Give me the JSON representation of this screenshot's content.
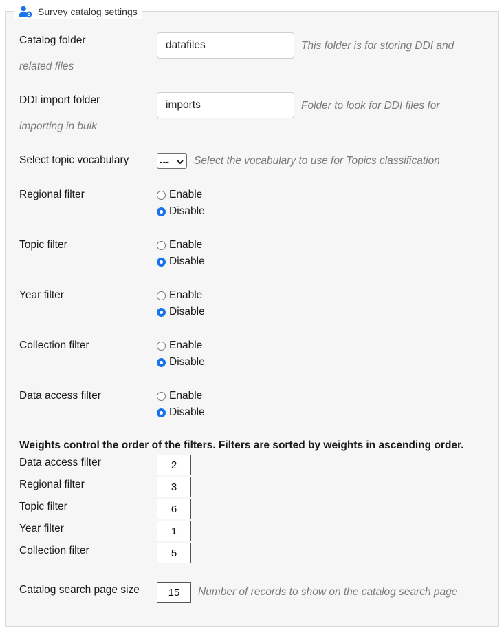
{
  "legend": {
    "title": "Survey catalog settings",
    "icon": "user-gear-icon"
  },
  "catalog_folder": {
    "label": "Catalog folder",
    "value": "datafiles",
    "help_line1": "This folder is for storing DDI and",
    "help_line2": "related files"
  },
  "ddi_import_folder": {
    "label": "DDI import folder",
    "value": "imports",
    "help_line1": "Folder to look for DDI files for",
    "help_line2": "importing in bulk"
  },
  "topic_vocabulary": {
    "label": "Select topic vocabulary",
    "selected": "---",
    "help": "Select the vocabulary to use for Topics classification"
  },
  "filters": [
    {
      "label": "Regional filter",
      "enable": "Enable",
      "disable": "Disable",
      "value": "Disable"
    },
    {
      "label": "Topic filter",
      "enable": "Enable",
      "disable": "Disable",
      "value": "Disable"
    },
    {
      "label": "Year filter",
      "enable": "Enable",
      "disable": "Disable",
      "value": "Disable"
    },
    {
      "label": "Collection filter",
      "enable": "Enable",
      "disable": "Disable",
      "value": "Disable"
    },
    {
      "label": "Data access filter",
      "enable": "Enable",
      "disable": "Disable",
      "value": "Disable"
    }
  ],
  "weights": {
    "title": "Weights control the order of the filters. Filters are sorted by weights in ascending order.",
    "items": [
      {
        "label": "Data access filter",
        "value": "2"
      },
      {
        "label": "Regional filter",
        "value": "3"
      },
      {
        "label": "Topic filter",
        "value": "6"
      },
      {
        "label": "Year filter",
        "value": "1"
      },
      {
        "label": "Collection filter",
        "value": "5"
      }
    ]
  },
  "page_size": {
    "label": "Catalog search page size",
    "value": "15",
    "help": "Number of records to show on the catalog search page"
  },
  "colors": {
    "accent": "#1a73e8",
    "panel": "#f6f6f6",
    "help_text": "#7a7a7a"
  }
}
